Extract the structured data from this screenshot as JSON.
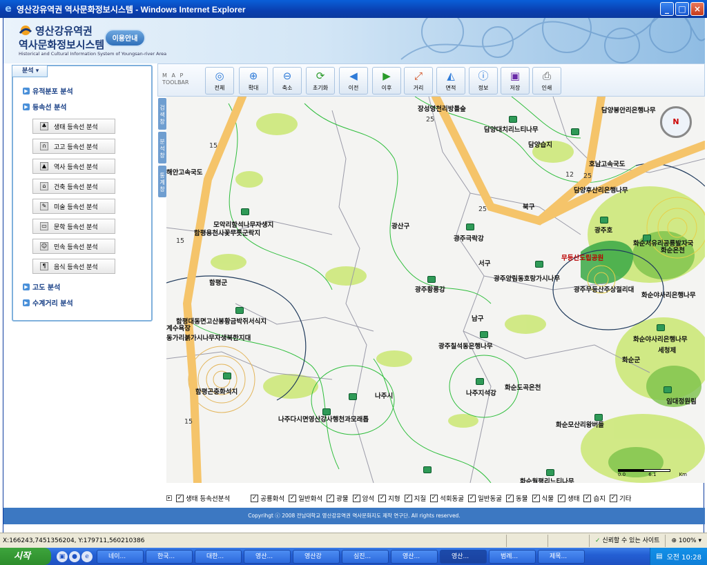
{
  "window": {
    "title": "영산강유역권 역사문화정보시스템 - Windows Internet Explorer"
  },
  "header": {
    "title_line1": "영산강유역권",
    "title_line2": "역사문화정보시스템",
    "subtitle": "Historical and Cultural Information System of Youngsan-river Area",
    "guide_button": "이용안내"
  },
  "sidebar": {
    "tab_label": "분석",
    "menu": [
      {
        "label": "유적분포 분석"
      },
      {
        "label": "등속선 분석"
      }
    ],
    "sub_items": [
      {
        "label": "생태 등속선 분석"
      },
      {
        "label": "고고 등속선 분석"
      },
      {
        "label": "역사 등속선 분석"
      },
      {
        "label": "건축 등속선 분석"
      },
      {
        "label": "미술 등속선 분석"
      },
      {
        "label": "문학 등속선 분석"
      },
      {
        "label": "민속 등속선 분석"
      },
      {
        "label": "음식 등속선 분석"
      }
    ],
    "menu_after": [
      {
        "label": "고도 분석"
      },
      {
        "label": "수계거리 분석"
      }
    ]
  },
  "toolbar": {
    "label_line1": "M A P",
    "label_line2": "TOOLBAR",
    "buttons": [
      {
        "label": "전체",
        "icon": "full-extent-icon"
      },
      {
        "label": "확대",
        "icon": "zoom-in-icon"
      },
      {
        "label": "축소",
        "icon": "zoom-out-icon"
      },
      {
        "label": "초기화",
        "icon": "reset-icon"
      },
      {
        "label": "이전",
        "icon": "back-icon"
      },
      {
        "label": "이후",
        "icon": "forward-icon"
      },
      {
        "label": "거리",
        "icon": "distance-icon"
      },
      {
        "label": "면적",
        "icon": "area-icon"
      },
      {
        "label": "정보",
        "icon": "info-icon"
      },
      {
        "label": "저장",
        "icon": "save-icon"
      },
      {
        "label": "인쇄",
        "icon": "print-icon"
      }
    ]
  },
  "side_tabs": [
    "검색창",
    "분석창",
    "통계창"
  ],
  "map": {
    "labels": [
      {
        "text": "장성영천리방틀숲"
      },
      {
        "text": "담양봉안리은행나무"
      },
      {
        "text": "담양대치리느티나무"
      },
      {
        "text": "담양습지"
      },
      {
        "text": "해안고속국도"
      },
      {
        "text": "호남고속국도"
      },
      {
        "text": "담양후산리은행나무"
      },
      {
        "text": "북구"
      },
      {
        "text": "광산구"
      },
      {
        "text": "광주호"
      },
      {
        "text": "모악리함석나무자생지"
      },
      {
        "text": "함평용천사꽃무릇군락지"
      },
      {
        "text": "광주극락강"
      },
      {
        "text": "화순서유리공룡발자국"
      },
      {
        "text": "화순온천"
      },
      {
        "text": "무등산도립공원"
      },
      {
        "text": "서구"
      },
      {
        "text": "광주양림동호랑가시나무"
      },
      {
        "text": "함평군"
      },
      {
        "text": "광주황룡강"
      },
      {
        "text": "광주무등산주상절리대"
      },
      {
        "text": "화순야사리은행나무"
      },
      {
        "text": "함평대동면고산봉황금박쥐서식지"
      },
      {
        "text": "남구"
      },
      {
        "text": "계수욕장"
      },
      {
        "text": "광주칠석동은행나무"
      },
      {
        "text": "화순야사리은행나무"
      },
      {
        "text": "동가리붉가시나무자생북한지대"
      },
      {
        "text": "세청제"
      },
      {
        "text": "화순군"
      },
      {
        "text": "함평곤충화석지"
      },
      {
        "text": "나주시"
      },
      {
        "text": "나주지석강"
      },
      {
        "text": "화순도곡온천"
      },
      {
        "text": "임대정원림"
      },
      {
        "text": "나주다시면영산강사행천과모래톱"
      },
      {
        "text": "화순모산리왕버들"
      },
      {
        "text": "화순월평리느티나무"
      }
    ],
    "road_numbers": [
      "25",
      "15",
      "12",
      "25",
      "25",
      "15",
      "15"
    ],
    "scale_label": "Km",
    "scale_ticks": [
      "0.0",
      "6.1"
    ],
    "compass_label": "N"
  },
  "legend": {
    "main": "생태 등속선분석",
    "items": [
      "공룡화석",
      "일반화석",
      "광물",
      "암석",
      "지형",
      "지질",
      "석회동굴",
      "일반동굴",
      "동물",
      "식물",
      "생태",
      "습지",
      "기타"
    ]
  },
  "footer": {
    "text": "Copyrihgt ⓒ 2008 전남대학교 영산강유역권 역사문화지도 제작 연구단. All rights reserved."
  },
  "statusbar": {
    "coords": "X:166243,7451356204, Y:179711,560210386",
    "trust": "신뢰할 수 있는 사이트",
    "zoom": "100%"
  },
  "taskbar": {
    "start": "시작",
    "tasks": [
      "네이...",
      "한국...",
      "대한...",
      "영산...",
      "영산강",
      "심진...",
      "영산...",
      "영산...",
      "범례...",
      "제목..."
    ],
    "clock": "오전 10:28"
  }
}
